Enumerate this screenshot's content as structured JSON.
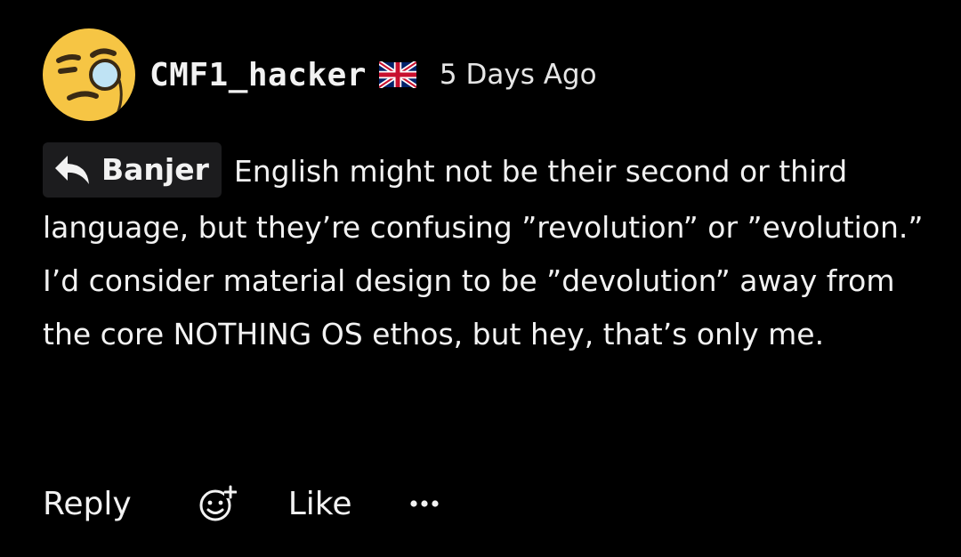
{
  "comment": {
    "author": {
      "username": "CMF1_hacker",
      "avatar_icon": "monocle-face-emoji",
      "flag_icon": "uk-flag-icon"
    },
    "timestamp": "5 Days Ago",
    "reply_to": {
      "icon": "reply-arrow-icon",
      "name": "Banjer"
    },
    "text": "English might not be their second or third language, but they’re confusing ”revolution” or ”evolution.” I’d consider material design to be ”devolution” away from the core NOTHING OS ethos, but hey, that’s only me."
  },
  "actions": {
    "reply_label": "Reply",
    "react_icon": "add-reaction-icon",
    "like_label": "Like",
    "more_icon": "more-dots-icon"
  },
  "colors": {
    "background": "#000000",
    "text": "#f2f2f2",
    "chip_background": "#1c1c1e",
    "avatar_yellow": "#f6c544"
  }
}
